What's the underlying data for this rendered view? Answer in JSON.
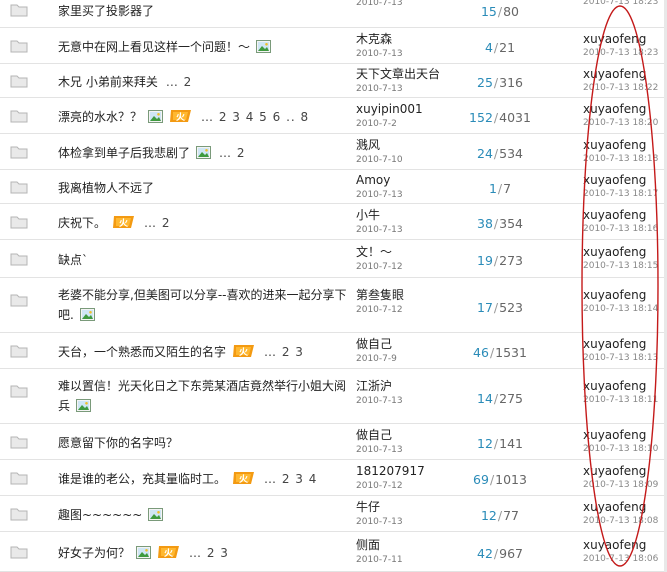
{
  "threads": [
    {
      "title": "家里买了投影器了",
      "pic": false,
      "hot": false,
      "pages": "",
      "author": "",
      "author_date": "2010-7-13",
      "replies": "15",
      "views": "80",
      "last_user": "",
      "last_date": "2010-7-13 18:23"
    },
    {
      "title": "无意中在网上看见这样一个问题！～",
      "pic": true,
      "hot": false,
      "pages": "",
      "author": "木克森",
      "author_date": "2010-7-13",
      "replies": "4",
      "views": "21",
      "last_user": "xuyaofeng",
      "last_date": "2010-7-13 18:23"
    },
    {
      "title": "木兄 小弟前来拜关",
      "pic": false,
      "hot": false,
      "pages": "… 2",
      "author": "天下文章出天台",
      "author_date": "2010-7-13",
      "replies": "25",
      "views": "316",
      "last_user": "xuyaofeng",
      "last_date": "2010-7-13 18:22"
    },
    {
      "title": "漂亮的水水？？",
      "pic": true,
      "hot": true,
      "pages": "… 2 3 4 5 6 .. 8",
      "author": "xuyipin001",
      "author_date": "2010-7-2",
      "replies": "152",
      "views": "4031",
      "last_user": "xuyaofeng",
      "last_date": "2010-7-13 18:20"
    },
    {
      "title": "体检拿到单子后我悲剧了",
      "pic": true,
      "hot": false,
      "pages": "… 2",
      "author": "溅风",
      "author_date": "2010-7-10",
      "replies": "24",
      "views": "534",
      "last_user": "xuyaofeng",
      "last_date": "2010-7-13 18:18"
    },
    {
      "title": "我离植物人不远了",
      "pic": false,
      "hot": false,
      "pages": "",
      "author": "Amoy",
      "author_date": "2010-7-13",
      "replies": "1",
      "views": "7",
      "last_user": "xuyaofeng",
      "last_date": "2010-7-13 18:17"
    },
    {
      "title": "庆祝下。",
      "pic": false,
      "hot": true,
      "pages": "… 2",
      "author": "小牛",
      "author_date": "2010-7-13",
      "replies": "38",
      "views": "354",
      "last_user": "xuyaofeng",
      "last_date": "2010-7-13 18:16"
    },
    {
      "title": "缺点`",
      "pic": false,
      "hot": false,
      "pages": "",
      "author": "文！～",
      "author_date": "2010-7-12",
      "replies": "19",
      "views": "273",
      "last_user": "xuyaofeng",
      "last_date": "2010-7-13 18:15"
    },
    {
      "title": "老婆不能分享,但美图可以分享--喜欢的进来一起分享下吧.",
      "pic": true,
      "hot": false,
      "pages": "",
      "author": "第叁隻眼",
      "author_date": "2010-7-12",
      "replies": "17",
      "views": "523",
      "last_user": "xuyaofeng",
      "last_date": "2010-7-13 18:14"
    },
    {
      "title": "天台，一个熟悉而又陌生的名字",
      "pic": false,
      "hot": true,
      "pages": "… 2 3",
      "author": "做自己",
      "author_date": "2010-7-9",
      "replies": "46",
      "views": "1531",
      "last_user": "xuyaofeng",
      "last_date": "2010-7-13 18:13"
    },
    {
      "title": "难以置信！光天化日之下东莞某酒店竟然举行小姐大阅兵",
      "pic": true,
      "hot": false,
      "pages": "",
      "author": "江浙沪",
      "author_date": "2010-7-13",
      "replies": "14",
      "views": "275",
      "last_user": "xuyaofeng",
      "last_date": "2010-7-13 18:11"
    },
    {
      "title": "愿意留下你的名字吗？",
      "pic": false,
      "hot": false,
      "pages": "",
      "author": "做自己",
      "author_date": "2010-7-13",
      "replies": "12",
      "views": "141",
      "last_user": "xuyaofeng",
      "last_date": "2010-7-13 18:10"
    },
    {
      "title": "谁是谁的老公，充其量临时工。",
      "pic": false,
      "hot": true,
      "pages": "… 2 3 4",
      "author": "181207917",
      "author_date": "2010-7-12",
      "replies": "69",
      "views": "1013",
      "last_user": "xuyaofeng",
      "last_date": "2010-7-13 18:09"
    },
    {
      "title": "趣图~~~~~~",
      "pic": true,
      "hot": false,
      "pages": "",
      "author": "牛仔",
      "author_date": "2010-7-13",
      "replies": "12",
      "views": "77",
      "last_user": "xuyaofeng",
      "last_date": "2010-7-13 18:08"
    },
    {
      "title": "好女子为何？",
      "pic": true,
      "hot": true,
      "pages": "… 2 3",
      "author": "侧面",
      "author_date": "2010-7-11",
      "replies": "42",
      "views": "967",
      "last_user": "xuyaofeng",
      "last_date": "2010-7-13 18:06"
    }
  ],
  "colors": {
    "reply_count": "#2a8bb8",
    "annotation_oval": "#c41a1a",
    "row_border": "#e3e3e3"
  },
  "icons": {
    "folder": "folder-icon",
    "image": "image-attachment-icon",
    "hot": "hot-fire-icon"
  }
}
